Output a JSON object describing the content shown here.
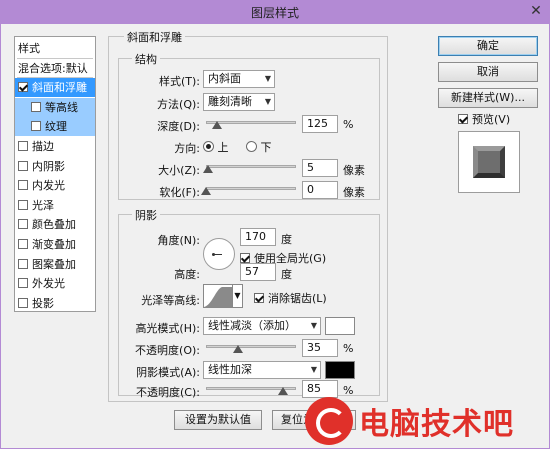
{
  "window": {
    "title": "图层样式",
    "close_glyph": "✕"
  },
  "left_list": {
    "items": [
      {
        "label": "样式",
        "checkbox": false,
        "checked": false,
        "state": "normal"
      },
      {
        "label": "混合选项:默认",
        "checkbox": false,
        "checked": false,
        "state": "normal"
      },
      {
        "label": "斜面和浮雕",
        "checkbox": true,
        "checked": true,
        "state": "selected"
      },
      {
        "label": "等高线",
        "checkbox": true,
        "checked": false,
        "state": "sub"
      },
      {
        "label": "纹理",
        "checkbox": true,
        "checked": false,
        "state": "sub"
      },
      {
        "label": "描边",
        "checkbox": true,
        "checked": false,
        "state": "normal"
      },
      {
        "label": "内阴影",
        "checkbox": true,
        "checked": false,
        "state": "normal"
      },
      {
        "label": "内发光",
        "checkbox": true,
        "checked": false,
        "state": "normal"
      },
      {
        "label": "光泽",
        "checkbox": true,
        "checked": false,
        "state": "normal"
      },
      {
        "label": "颜色叠加",
        "checkbox": true,
        "checked": false,
        "state": "normal"
      },
      {
        "label": "渐变叠加",
        "checkbox": true,
        "checked": false,
        "state": "normal"
      },
      {
        "label": "图案叠加",
        "checkbox": true,
        "checked": false,
        "state": "normal"
      },
      {
        "label": "外发光",
        "checkbox": true,
        "checked": false,
        "state": "normal"
      },
      {
        "label": "投影",
        "checkbox": true,
        "checked": false,
        "state": "normal"
      }
    ]
  },
  "bevel": {
    "group_title": "斜面和浮雕",
    "structure_title": "结构",
    "style_label": "样式(T):",
    "style_value": "内斜面",
    "technique_label": "方法(Q):",
    "technique_value": "雕刻清晰",
    "depth_label": "深度(D):",
    "depth_value": "125",
    "depth_unit": "%",
    "depth_level": 0.125,
    "direction_label": "方向:",
    "direction_up": "上",
    "direction_down": "下",
    "size_label": "大小(Z):",
    "size_value": "5",
    "size_unit": "像素",
    "size_level": 0.02,
    "soften_label": "软化(F):",
    "soften_value": "0",
    "soften_unit": "像素",
    "soften_level": 0.0
  },
  "shading": {
    "title": "阴影",
    "angle_label": "角度(N):",
    "angle_value": "170",
    "angle_unit": "度",
    "global_light_label": "使用全局光(G)",
    "global_light_checked": true,
    "altitude_label": "高度:",
    "altitude_value": "57",
    "altitude_unit": "度",
    "gloss_label": "光泽等高线:",
    "antialias_label": "消除锯齿(L)",
    "antialias_checked": true,
    "highlight_mode_label": "高光模式(H):",
    "highlight_mode_value": "线性减淡（添加）",
    "highlight_color": "#ffffff",
    "highlight_opacity_label": "不透明度(O):",
    "highlight_opacity_value": "35",
    "highlight_opacity_level": 0.35,
    "shadow_mode_label": "阴影模式(A):",
    "shadow_mode_value": "线性加深",
    "shadow_color": "#000000",
    "shadow_opacity_label": "不透明度(C):",
    "shadow_opacity_value": "85",
    "shadow_opacity_level": 0.85,
    "percent": "%"
  },
  "footer": {
    "make_default": "设置为默认值",
    "reset_default": "复位为默认值"
  },
  "right_panel": {
    "ok": "确定",
    "cancel": "取消",
    "new_style": "新建样式(W)...",
    "preview_label": "预览(V)",
    "preview_checked": true
  },
  "watermark": {
    "text": "电脑技术吧"
  },
  "colors": {
    "titlebar": "#b38ad4",
    "selection": "#3399ff",
    "subselection": "#99ccff",
    "watermark": "#e0302a"
  }
}
